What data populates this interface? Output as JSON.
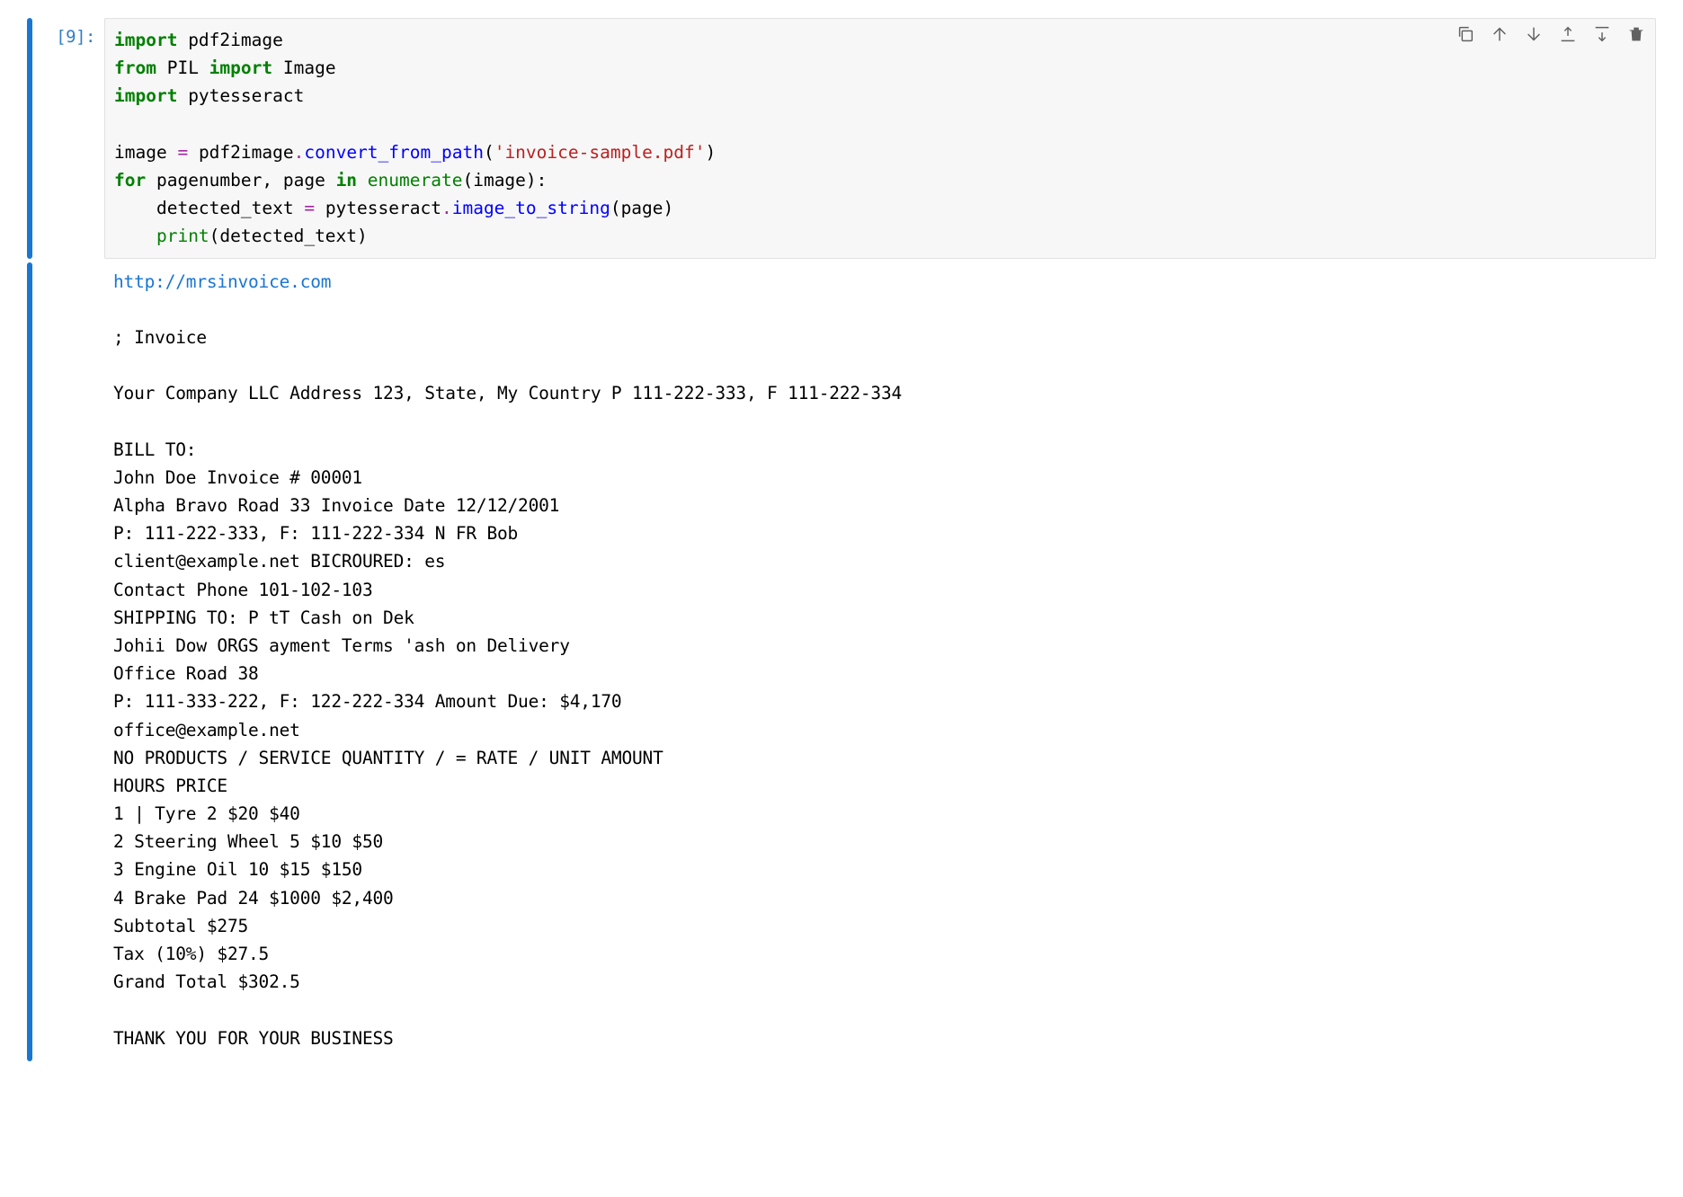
{
  "input": {
    "prompt": "[9]:",
    "code_tokens": [
      [
        {
          "t": "import",
          "c": "kw"
        },
        {
          "t": " pdf2image",
          "c": "nm"
        }
      ],
      [
        {
          "t": "from",
          "c": "kw"
        },
        {
          "t": " PIL ",
          "c": "nm"
        },
        {
          "t": "import",
          "c": "kw"
        },
        {
          "t": " Image",
          "c": "nm"
        }
      ],
      [
        {
          "t": "import",
          "c": "kw"
        },
        {
          "t": " pytesseract",
          "c": "nm"
        }
      ],
      [],
      [
        {
          "t": "image ",
          "c": "nm"
        },
        {
          "t": "=",
          "c": "op"
        },
        {
          "t": " pdf2image",
          "c": "nm"
        },
        {
          "t": ".",
          "c": "op"
        },
        {
          "t": "convert_from_path",
          "c": "fn"
        },
        {
          "t": "(",
          "c": "nm"
        },
        {
          "t": "'invoice-sample.pdf'",
          "c": "str"
        },
        {
          "t": ")",
          "c": "nm"
        }
      ],
      [
        {
          "t": "for",
          "c": "kw"
        },
        {
          "t": " pagenumber, page ",
          "c": "nm"
        },
        {
          "t": "in",
          "c": "kw"
        },
        {
          "t": " ",
          "c": "nm"
        },
        {
          "t": "enumerate",
          "c": "bi"
        },
        {
          "t": "(image):",
          "c": "nm"
        }
      ],
      [
        {
          "t": "    detected_text ",
          "c": "nm"
        },
        {
          "t": "=",
          "c": "op"
        },
        {
          "t": " pytesseract",
          "c": "nm"
        },
        {
          "t": ".",
          "c": "op"
        },
        {
          "t": "image_to_string",
          "c": "fn"
        },
        {
          "t": "(page)",
          "c": "nm"
        }
      ],
      [
        {
          "t": "    ",
          "c": "nm"
        },
        {
          "t": "print",
          "c": "bi"
        },
        {
          "t": "(detected_text)",
          "c": "nm"
        }
      ]
    ],
    "toolbar": {
      "duplicate": "duplicate-icon",
      "move_up": "arrow-up-icon",
      "move_down": "arrow-down-icon",
      "insert_above": "insert-above-icon",
      "insert_below": "insert-below-icon",
      "delete": "trash-icon"
    }
  },
  "output": {
    "link": "http://mrsinvoice.com",
    "lines": [
      "",
      "; Invoice",
      "",
      "Your Company LLC Address 123, State, My Country P 111-222-333, F 111-222-334",
      "",
      "BILL TO:",
      "John Doe Invoice # 00001",
      "Alpha Bravo Road 33 Invoice Date 12/12/2001",
      "P: 111-222-333, F: 111-222-334 N FR Bob",
      "client@example.net BICROURED: es",
      "Contact Phone 101-102-103",
      "SHIPPING TO: P tT Cash on Dek",
      "Johii Dow ORGS ayment Terms 'ash on Delivery",
      "Office Road 38",
      "P: 111-333-222, F: 122-222-334 Amount Due: $4,170",
      "office@example.net",
      "NO PRODUCTS / SERVICE QUANTITY / = RATE / UNIT AMOUNT",
      "HOURS PRICE",
      "1 | Tyre 2 $20 $40",
      "2 Steering Wheel 5 $10 $50",
      "3 Engine Oil 10 $15 $150",
      "4 Brake Pad 24 $1000 $2,400",
      "Subtotal $275",
      "Tax (10%) $27.5",
      "Grand Total $302.5",
      "",
      "THANK YOU FOR YOUR BUSINESS"
    ]
  }
}
